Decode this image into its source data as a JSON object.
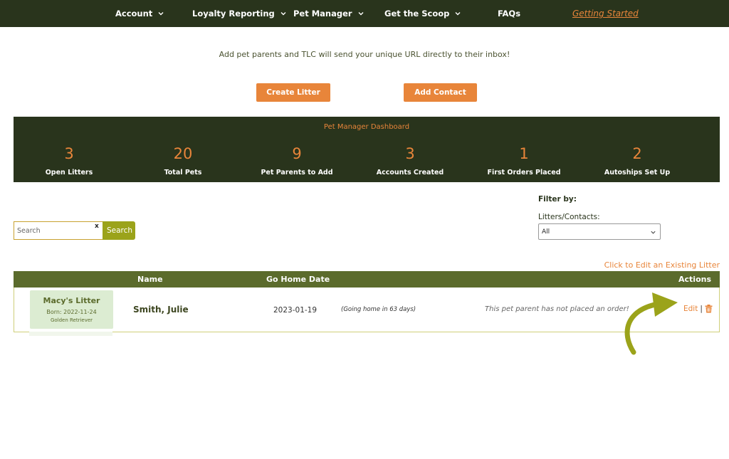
{
  "nav": {
    "items": [
      {
        "label": "Account",
        "has_dropdown": true
      },
      {
        "label": "Loyalty Reporting",
        "has_dropdown": true
      },
      {
        "label": "Pet Manager",
        "has_dropdown": true
      },
      {
        "label": "Get the Scoop",
        "has_dropdown": true
      },
      {
        "label": "FAQs",
        "has_dropdown": false
      },
      {
        "label": "Getting Started",
        "has_dropdown": false
      }
    ]
  },
  "intro": {
    "text": "Add pet parents and TLC will send your unique URL directly to their inbox!",
    "create_litter_label": "Create Litter",
    "add_contact_label": "Add Contact"
  },
  "dashboard": {
    "title": "Pet Manager Dashboard",
    "stats": [
      {
        "value": "3",
        "label": "Open Litters"
      },
      {
        "value": "20",
        "label": "Total Pets"
      },
      {
        "value": "9",
        "label": "Pet Parents to Add"
      },
      {
        "value": "3",
        "label": "Accounts Created"
      },
      {
        "value": "1",
        "label": "First Orders Placed"
      },
      {
        "value": "2",
        "label": "Autoships Set Up"
      }
    ]
  },
  "search": {
    "placeholder": "Search",
    "clear_label": "x",
    "button_label": "Search"
  },
  "filter": {
    "heading": "Filter by:",
    "label": "Litters/Contacts:",
    "selected": "All"
  },
  "edit_hint": "Click to Edit an Existing Litter",
  "table": {
    "headers": {
      "name": "Name",
      "go_home_date": "Go Home Date",
      "actions": "Actions"
    },
    "rows": [
      {
        "litter_name": "Macy's Litter",
        "born": "Born: 2022-11-24",
        "breed": "Golden Retriever",
        "name": "Smith, Julie",
        "go_home_date": "2023-01-19",
        "going_home": "(Going home in 63 days)",
        "order_status": "This pet parent has not placed an order!",
        "edit_label": "Edit",
        "separator": "|"
      }
    ]
  },
  "colors": {
    "nav_bg": "#29341c",
    "accent_orange": "#e8853a",
    "table_header": "#5b6b2c",
    "search_button": "#9ba31a",
    "litter_card": "#dcecd2",
    "arrow": "#9ba31a"
  },
  "icons": {
    "dropdown": "chevron-down-icon",
    "delete": "trash-icon",
    "select": "chevron-down-icon",
    "annotation": "curved-arrow-icon"
  }
}
